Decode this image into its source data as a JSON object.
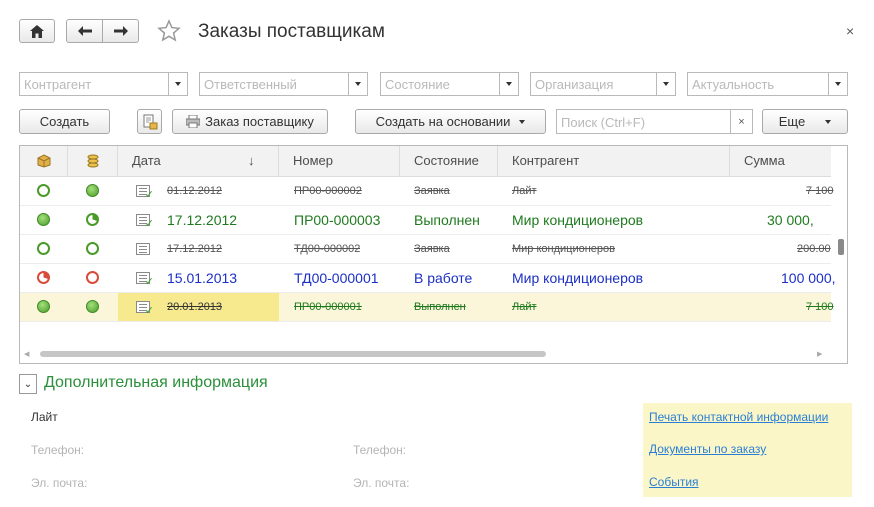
{
  "window": {
    "title": "Заказы поставщикам",
    "close_icon": "×"
  },
  "nav": {
    "home_icon": "home-icon",
    "back_icon": "arrow-left-icon",
    "forward_icon": "arrow-right-icon",
    "favorite_icon": "star-icon"
  },
  "filters": [
    {
      "placeholder": "Контрагент"
    },
    {
      "placeholder": "Ответственный"
    },
    {
      "placeholder": "Состояние"
    },
    {
      "placeholder": "Организация"
    },
    {
      "placeholder": "Актуальность"
    }
  ],
  "toolbar": {
    "create_label": "Создать",
    "print_label": "Заказ поставщику",
    "based_on_label": "Создать на основании",
    "search_placeholder": "Поиск (Ctrl+F)",
    "search_clear": "×",
    "more_label": "Еще"
  },
  "table": {
    "columns": [
      "Дата",
      "Номер",
      "Состояние",
      "Контрагент",
      "Сумма"
    ],
    "sort_indicator": "↓",
    "rows": [
      {
        "date": "01.12.2012",
        "number": "ПР00-000002",
        "state": "Заявка",
        "counterparty": "Лайт",
        "sum": "7 100",
        "deleted": true,
        "style": "gray"
      },
      {
        "date": "17.12.2012",
        "number": "ПР00-000003",
        "state": "Выполнен",
        "counterparty": "Мир кондиционеров",
        "sum": "30 000,",
        "deleted": false,
        "style": "green"
      },
      {
        "date": "17.12.2012",
        "number": "ТД00-000002",
        "state": "Заявка",
        "counterparty": "Мир кондиционеров",
        "sum": "200.00",
        "deleted": true,
        "style": "gray"
      },
      {
        "date": "15.01.2013",
        "number": "ТД00-000001",
        "state": "В работе",
        "counterparty": "Мир кондиционеров",
        "sum": "100 000,",
        "deleted": false,
        "style": "blue"
      },
      {
        "date": "20.01.2013",
        "number": "ПР00-000001",
        "state": "Выполнен",
        "counterparty": "Лайт",
        "sum": "7 100",
        "deleted": true,
        "style": "green"
      }
    ]
  },
  "additional": {
    "toggle_icon": "chevron-down-icon",
    "title": "Дополнительная информация",
    "contact_name": "Лайт",
    "phone_label_1": "Телефон:",
    "phone_label_2": "Телефон:",
    "email_label_1": "Эл. почта:",
    "email_label_2": "Эл. почта:",
    "links": [
      "Печать контактной информации",
      "Документы по заказу",
      "События"
    ]
  },
  "colors": {
    "accent_green": "#2b8f3b",
    "selected_row": "#fbf6c8",
    "link": "#2a7fd4"
  }
}
